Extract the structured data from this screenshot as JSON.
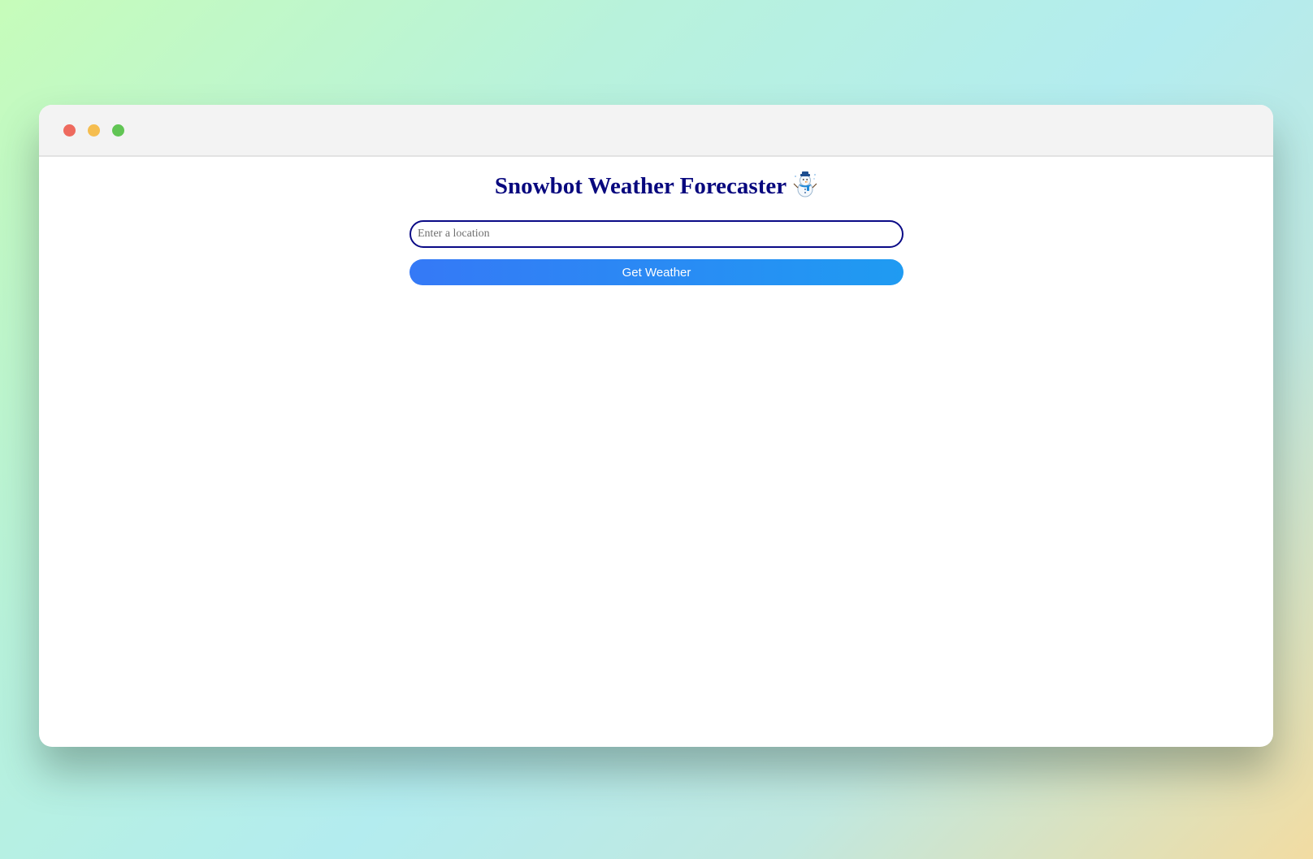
{
  "window": {
    "controls": [
      "close",
      "minimize",
      "maximize"
    ]
  },
  "app": {
    "title": "Snowbot Weather Forecaster",
    "title_icon": "snowman-icon"
  },
  "search": {
    "placeholder": "Enter a location",
    "value": ""
  },
  "actions": {
    "get_weather_label": "Get Weather"
  },
  "colors": {
    "title": "#08087e",
    "input_border": "#0a0a86",
    "button_gradient_start": "#3579f6",
    "button_gradient_end": "#1f9bf2",
    "close": "#ee6a5e",
    "minimize": "#f5bd4f",
    "maximize": "#61c554"
  }
}
